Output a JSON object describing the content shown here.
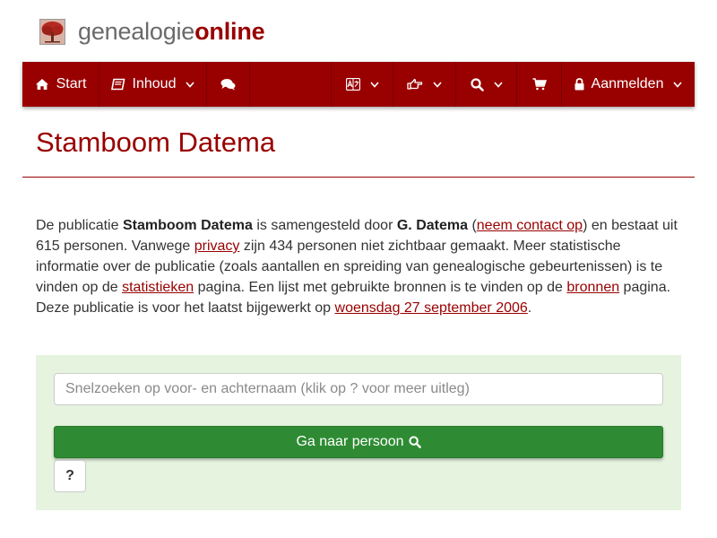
{
  "brand": {
    "part1": "genealogie",
    "part2": "online"
  },
  "nav": {
    "start": "Start",
    "inhoud": "Inhoud",
    "aanmelden": "Aanmelden",
    "icons": [
      "home-icon",
      "book-icon",
      "chat-icon",
      "language-icon",
      "hand-point-icon",
      "search-icon",
      "shopping-cart-icon",
      "lock-icon",
      "chevron-down-icon"
    ]
  },
  "page": {
    "title": "Stamboom Datema"
  },
  "intro": {
    "t1": "De publicatie ",
    "pub_name": "Stamboom Datema",
    "t2": " is samengesteld door ",
    "author": "G. Datema",
    "t3": " (",
    "contact_link": "neem contact op",
    "t4": ") en bestaat uit 615 personen. Vanwege ",
    "privacy_link": "privacy",
    "t5": " zijn 434 personen niet zichtbaar gemaakt. Meer statistische informatie over de publicatie (zoals aantallen en spreiding van genealogische gebeurtenissen) is te vinden op de ",
    "stats_link": "statistieken",
    "t6": " pagina. Een lijst met gebruikte bronnen is te vinden op de ",
    "sources_link": "bronnen",
    "t7": " pagina. Deze publicatie is voor het laatst bijgewerkt op ",
    "date_link": "woensdag 27 september 2006",
    "t8": "."
  },
  "search": {
    "placeholder": "Snelzoeken op voor- en achternaam (klik op ? voor meer uitleg)",
    "value": "",
    "go_label": "Ga naar persoon",
    "help_label": "?"
  },
  "colors": {
    "brand_red": "#990000",
    "panel_green": "#e5f3df",
    "button_green": "#2e8b33"
  }
}
